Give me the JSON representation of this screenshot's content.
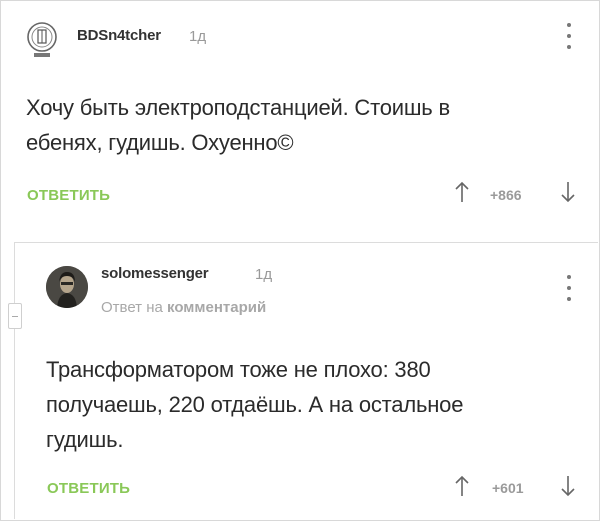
{
  "comment1": {
    "username": "BDSn4tcher",
    "time": "1д",
    "avatar_icon": "round-badge-avatar-icon",
    "text_line1": "Хочу быть электроподстанцией. Стоишь в",
    "text_line2": "ебенях, гудишь. Охуенно©",
    "reply_label": "ОТВЕТИТЬ",
    "rating": "+866"
  },
  "comment2": {
    "username": "solomessenger",
    "time": "1д",
    "reply_to_prefix": "Ответ на",
    "reply_to_link": "комментарий",
    "text_line1": "Трансформатором тоже не плохо: 380",
    "text_line2": "получаешь, 220 отдаёшь. А на остальное",
    "text_line3": "гудишь.",
    "reply_label": "ОТВЕТИТЬ",
    "rating": "+601"
  },
  "colors": {
    "reply_green": "#8ac858",
    "muted_gray": "#9a9a9a",
    "text": "#2b2b2b"
  }
}
